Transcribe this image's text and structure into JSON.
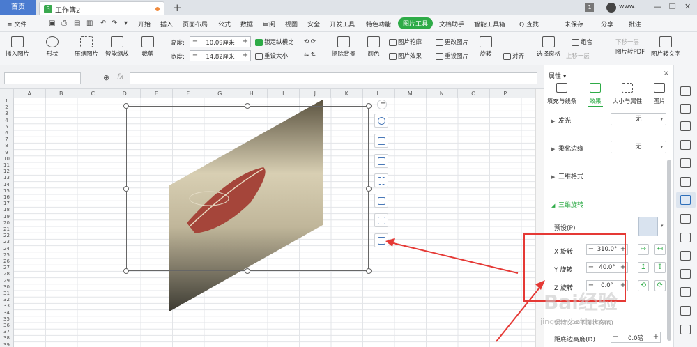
{
  "tabs": {
    "home": "首页",
    "doc": "工作簿2",
    "badge": "1",
    "user": "www."
  },
  "window_controls": [
    "—",
    "❐",
    "✕"
  ],
  "menu": {
    "file": "≡ 文件",
    "items": [
      "开始",
      "插入",
      "页面布局",
      "公式",
      "数据",
      "审阅",
      "视图",
      "安全",
      "开发工具",
      "特色功能",
      "图片工具",
      "文档助手",
      "智能工具箱",
      "Q 查找"
    ],
    "active": "图片工具",
    "save": "未保存",
    "share": "分享",
    "comment": "批注"
  },
  "ribbon": {
    "insert_pic": "插入图片",
    "shape": "形状",
    "compress": "压缩图片",
    "smart_zoom": "智能缩放",
    "crop": "裁剪",
    "height_label": "高度:",
    "height_value": "10.09厘米",
    "width_label": "宽度:",
    "width_value": "14.82厘米",
    "lock_ratio": "锁定纵横比",
    "reset_size": "重设大小",
    "remove_bg": "抠除背景",
    "color": "颜色",
    "outline": "图片轮廓",
    "effect": "图片效果",
    "change_pic": "更改图片",
    "reset_pic": "重设图片",
    "rotate": "旋转",
    "align": "对齐",
    "select_pane": "选择窗格",
    "group": "组合",
    "bring_forward": "上移一层",
    "send_backward": "下移一层",
    "to_pdf": "图片转PDF",
    "to_text": "图片转文字"
  },
  "formula": {
    "namebox": "",
    "fx": "fx",
    "value": ""
  },
  "grid": {
    "columns": [
      "A",
      "B",
      "C",
      "D",
      "E",
      "F",
      "G",
      "H",
      "I",
      "J",
      "K",
      "L",
      "M",
      "N",
      "O",
      "P",
      "Q"
    ],
    "rows": [
      "1",
      "2",
      "3",
      "4",
      "5",
      "6",
      "7",
      "8",
      "9",
      "10",
      "11",
      "12",
      "13",
      "14",
      "15",
      "16",
      "17",
      "18",
      "19",
      "20",
      "21",
      "22",
      "23",
      "24",
      "25",
      "26",
      "27",
      "28",
      "29",
      "30",
      "31",
      "32",
      "33",
      "34",
      "35",
      "36",
      "37",
      "38",
      "39"
    ]
  },
  "float_tools": [
    "zoom-icon",
    "magic-crop-icon",
    "crop-icon",
    "frame-icon",
    "copy-icon",
    "format-icon",
    "layout-icon"
  ],
  "panel": {
    "title": "属性 ▾",
    "close": "×",
    "tabs": [
      "填充与线条",
      "效果",
      "大小与属性",
      "图片"
    ],
    "active_tab": "效果",
    "glow": "发光",
    "glow_value": "无",
    "soft_edge": "柔化边缘",
    "soft_edge_value": "无",
    "format3d": "三维格式",
    "rotate3d": "三维旋转",
    "preset": "预设(P)",
    "x_label": "X 旋转",
    "x_value": "310.0°",
    "y_label": "Y 旋转",
    "y_value": "40.0°",
    "z_label": "Z 旋转",
    "z_value": "0.0°",
    "keep_text": "保持文本平面状态(K)",
    "bottom_label": "距底边高度(D)",
    "bottom_value": "0.0磅"
  },
  "watermark": {
    "main": "Bai经验",
    "sub": "jingyan.baidu.com"
  },
  "colors": {
    "accent": "#2eab47",
    "home_tab": "#4a7bd0",
    "annotation": "#e53935"
  }
}
